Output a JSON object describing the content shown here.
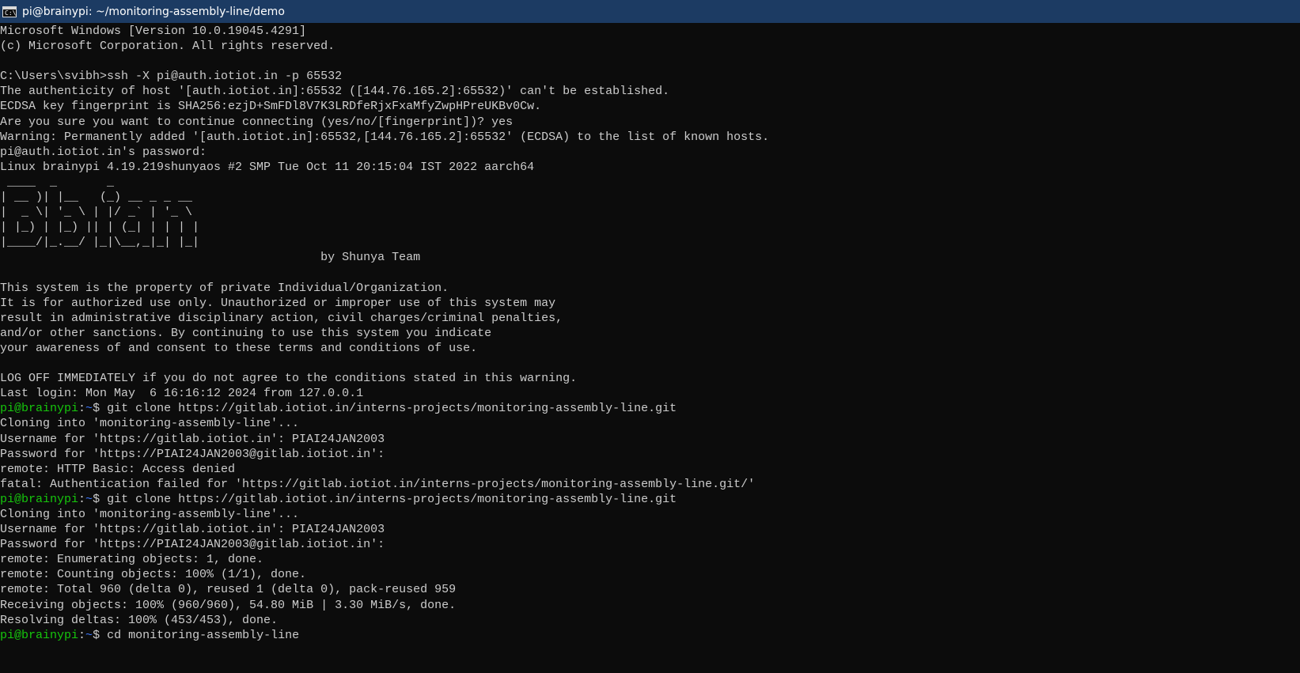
{
  "window": {
    "title": "pi@brainypi: ~/monitoring-assembly-line/demo",
    "icon": "terminal-icon",
    "icon_glyph": "C:\\"
  },
  "colors": {
    "background": "#0c0c0c",
    "titlebar": "#1c3b63",
    "text": "#cccccc",
    "prompt_user": "#16c60c",
    "prompt_path": "#3b78ff"
  },
  "terminal": {
    "lines": [
      {
        "text": "Microsoft Windows [Version 10.0.19045.4291]"
      },
      {
        "text": "(c) Microsoft Corporation. All rights reserved."
      },
      {
        "text": ""
      },
      {
        "text": "C:\\Users\\svibh>ssh -X pi@auth.iotiot.in -p 65532"
      },
      {
        "text": "The authenticity of host '[auth.iotiot.in]:65532 ([144.76.165.2]:65532)' can't be established."
      },
      {
        "text": "ECDSA key fingerprint is SHA256:ezjD+SmFDl8V7K3LRDfeRjxFxaMfyZwpHPreUKBv0Cw."
      },
      {
        "text": "Are you sure you want to continue connecting (yes/no/[fingerprint])? yes"
      },
      {
        "text": "Warning: Permanently added '[auth.iotiot.in]:65532,[144.76.165.2]:65532' (ECDSA) to the list of known hosts."
      },
      {
        "text": "pi@auth.iotiot.in's password:"
      },
      {
        "text": "Linux brainypi 4.19.219shunyaos #2 SMP Tue Oct 11 20:15:04 IST 2022 aarch64"
      },
      {
        "text": " ____  _       _"
      },
      {
        "text": "| __ )| |__   (_) __ _ _ __"
      },
      {
        "text": "|  _ \\| '_ \\ | |/ _` | '_ \\"
      },
      {
        "text": "| |_) | |_) || | (_| | | | |"
      },
      {
        "text": "|____/|_.__/ |_|\\__,_|_| |_|"
      },
      {
        "text": "                                             by Shunya Team"
      },
      {
        "text": ""
      },
      {
        "text": "This system is the property of private Individual/Organization."
      },
      {
        "text": "It is for authorized use only. Unauthorized or improper use of this system may"
      },
      {
        "text": "result in administrative disciplinary action, civil charges/criminal penalties,"
      },
      {
        "text": "and/or other sanctions. By continuing to use this system you indicate"
      },
      {
        "text": "your awareness of and consent to these terms and conditions of use."
      },
      {
        "text": ""
      },
      {
        "text": "LOG OFF IMMEDIATELY if you do not agree to the conditions stated in this warning."
      },
      {
        "text": "Last login: Mon May  6 16:16:12 2024 from 127.0.0.1"
      },
      {
        "prompt_user": "pi@brainypi",
        "prompt_sep": ":",
        "prompt_path": "~",
        "text": "$ git clone https://gitlab.iotiot.in/interns-projects/monitoring-assembly-line.git"
      },
      {
        "text": "Cloning into 'monitoring-assembly-line'..."
      },
      {
        "text": "Username for 'https://gitlab.iotiot.in': PIAI24JAN2003"
      },
      {
        "text": "Password for 'https://PIAI24JAN2003@gitlab.iotiot.in':"
      },
      {
        "text": "remote: HTTP Basic: Access denied"
      },
      {
        "text": "fatal: Authentication failed for 'https://gitlab.iotiot.in/interns-projects/monitoring-assembly-line.git/'"
      },
      {
        "prompt_user": "pi@brainypi",
        "prompt_sep": ":",
        "prompt_path": "~",
        "text": "$ git clone https://gitlab.iotiot.in/interns-projects/monitoring-assembly-line.git"
      },
      {
        "text": "Cloning into 'monitoring-assembly-line'..."
      },
      {
        "text": "Username for 'https://gitlab.iotiot.in': PIAI24JAN2003"
      },
      {
        "text": "Password for 'https://PIAI24JAN2003@gitlab.iotiot.in':"
      },
      {
        "text": "remote: Enumerating objects: 1, done."
      },
      {
        "text": "remote: Counting objects: 100% (1/1), done."
      },
      {
        "text": "remote: Total 960 (delta 0), reused 1 (delta 0), pack-reused 959"
      },
      {
        "text": "Receiving objects: 100% (960/960), 54.80 MiB | 3.30 MiB/s, done."
      },
      {
        "text": "Resolving deltas: 100% (453/453), done."
      },
      {
        "prompt_user": "pi@brainypi",
        "prompt_sep": ":",
        "prompt_path": "~",
        "text": "$ cd monitoring-assembly-line"
      }
    ]
  }
}
